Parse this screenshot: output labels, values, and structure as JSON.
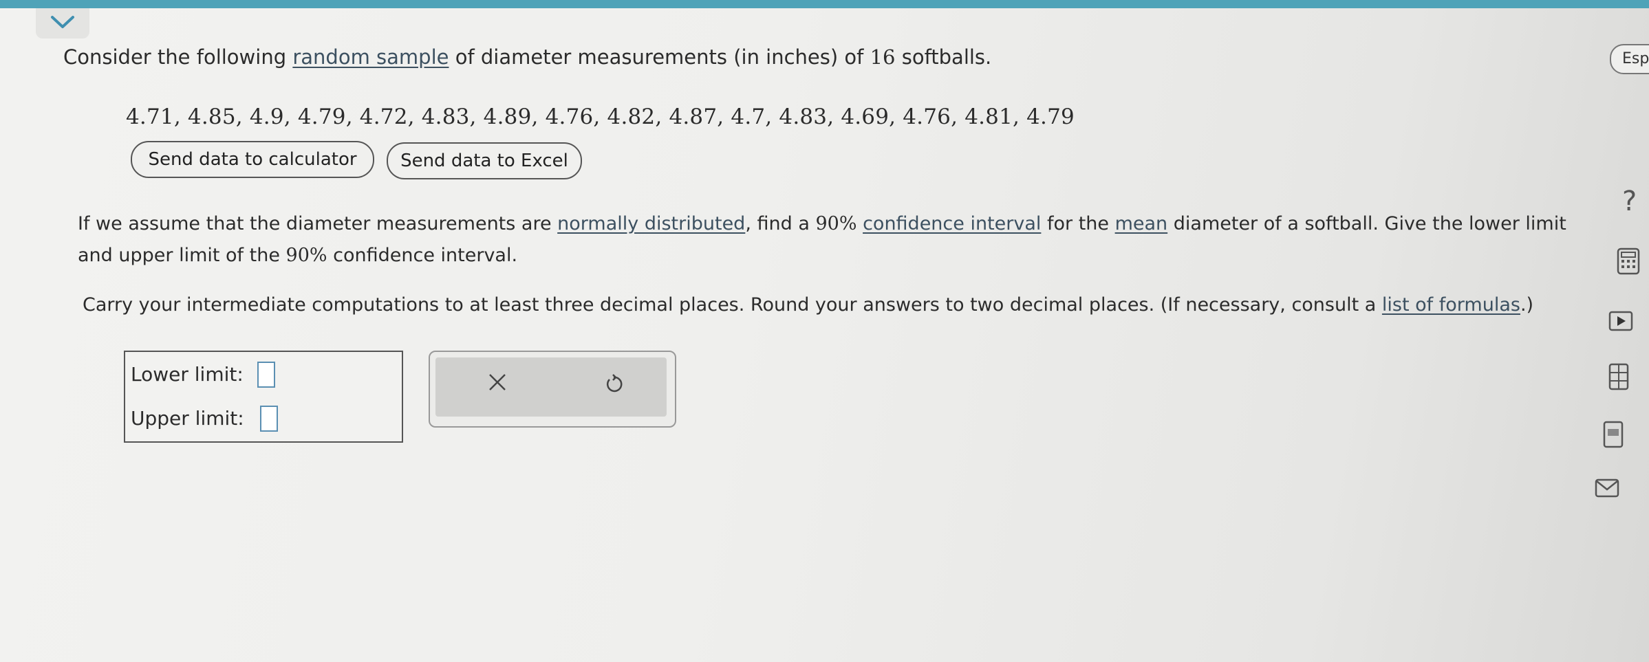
{
  "header": {
    "language_label": "Espa"
  },
  "question": {
    "intro_pre": "Consider the following ",
    "intro_link": "random sample",
    "intro_mid": " of diameter measurements (in inches) of ",
    "intro_num": "16",
    "intro_post": " softballs.",
    "data_values": "4.71, 4.85, 4.9, 4.79, 4.72, 4.83, 4.89, 4.76, 4.82, 4.87, 4.7, 4.83, 4.69, 4.76, 4.81, 4.79",
    "send_calc_label": "Send data to calculator",
    "send_excel_label": "Send data to Excel",
    "p2_a": "If we assume that the diameter measurements are ",
    "p2_link1": "normally distributed",
    "p2_b": ", find a ",
    "p2_pct": "90%",
    "p2_c": " ",
    "p2_link2": "confidence interval",
    "p2_d": " for the ",
    "p2_link3": "mean",
    "p2_e": " diameter of a softball. Give the lower limit",
    "p2_line2_a": "and upper limit of the ",
    "p2_line2_pct": "90%",
    "p2_line2_b": " confidence interval.",
    "p3_a": "Carry your intermediate computations to at least three decimal places. Round your answers to two decimal places. (If necessary, consult a ",
    "p3_link": "list of formulas",
    "p3_b": ".)"
  },
  "answer": {
    "lower_label": "Lower limit:",
    "upper_label": "Upper limit:",
    "lower_value": "",
    "upper_value": ""
  },
  "sidebar": {
    "help_label": "?",
    "icons": [
      "calculator-icon",
      "video-icon",
      "data-table-icon",
      "glossary-icon",
      "mail-icon"
    ]
  },
  "colors": {
    "topbar": "#4fa3b8",
    "input_border": "#5a8fb2"
  }
}
